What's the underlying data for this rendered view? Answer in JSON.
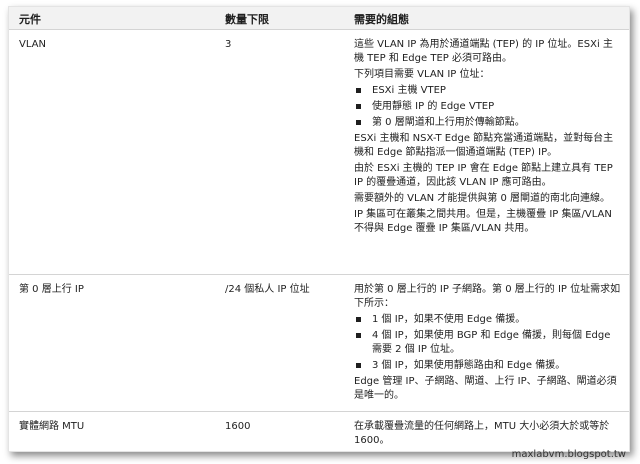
{
  "table": {
    "headers": [
      "元件",
      "數量下限",
      "需要的組態"
    ],
    "rows": [
      {
        "component": "VLAN",
        "minimum": "3",
        "config": [
          {
            "kind": "p",
            "text": "這些 VLAN IP 為用於通道端點 (TEP) 的 IP 位址。ESXi 主機 TEP 和 Edge TEP 必須可路由。"
          },
          {
            "kind": "p",
            "text": "下列項目需要 VLAN IP 位址："
          },
          {
            "kind": "li",
            "text": "ESXi 主機 VTEP"
          },
          {
            "kind": "li",
            "text": "使用靜態 IP 的 Edge VTEP"
          },
          {
            "kind": "li",
            "text": "第 0 層閘道和上行用於傳輸節點。"
          },
          {
            "kind": "p",
            "text": "ESXi 主機和 NSX-T Edge 節點充當通道端點，並對每台主機和 Edge 節點指派一個通道端點 (TEP) IP。"
          },
          {
            "kind": "p",
            "text": "由於 ESXi 主機的 TEP IP 會在 Edge 節點上建立具有 TEP IP 的覆疊通道，因此該 VLAN IP 應可路由。"
          },
          {
            "kind": "p",
            "text": "需要額外的 VLAN 才能提供與第 0 層閘道的南北向連線。"
          },
          {
            "kind": "p",
            "text": "IP 集區可在叢集之間共用。但是，主機覆疊 IP 集區/VLAN 不得與 Edge 覆疊 IP 集區/VLAN 共用。"
          }
        ]
      },
      {
        "component": "第 0 層上行 IP",
        "minimum": "/24 個私人 IP 位址",
        "config": [
          {
            "kind": "p",
            "text": "用於第 0 層上行的 IP 子網路。第 0 層上行的 IP 位址需求如下所示："
          },
          {
            "kind": "li",
            "text": "1 個 IP，如果不使用 Edge 備援。"
          },
          {
            "kind": "li",
            "text": "4 個 IP，如果使用 BGP 和 Edge 備援，則每個 Edge 需要 2 個 IP 位址。"
          },
          {
            "kind": "li",
            "text": "3 個 IP，如果使用靜態路由和 Edge 備援。"
          },
          {
            "kind": "p",
            "text": "Edge 管理 IP、子網路、閘道、上行 IP、子網路、閘道必須是唯一的。"
          }
        ]
      },
      {
        "component": "實體網路 MTU",
        "minimum": "1600",
        "config": [
          {
            "kind": "p",
            "text": "在承載覆疊流量的任何網路上，MTU 大小必須大於或等於 1600。"
          }
        ]
      }
    ]
  },
  "watermark": "maxlabvm.blogspot.tw"
}
